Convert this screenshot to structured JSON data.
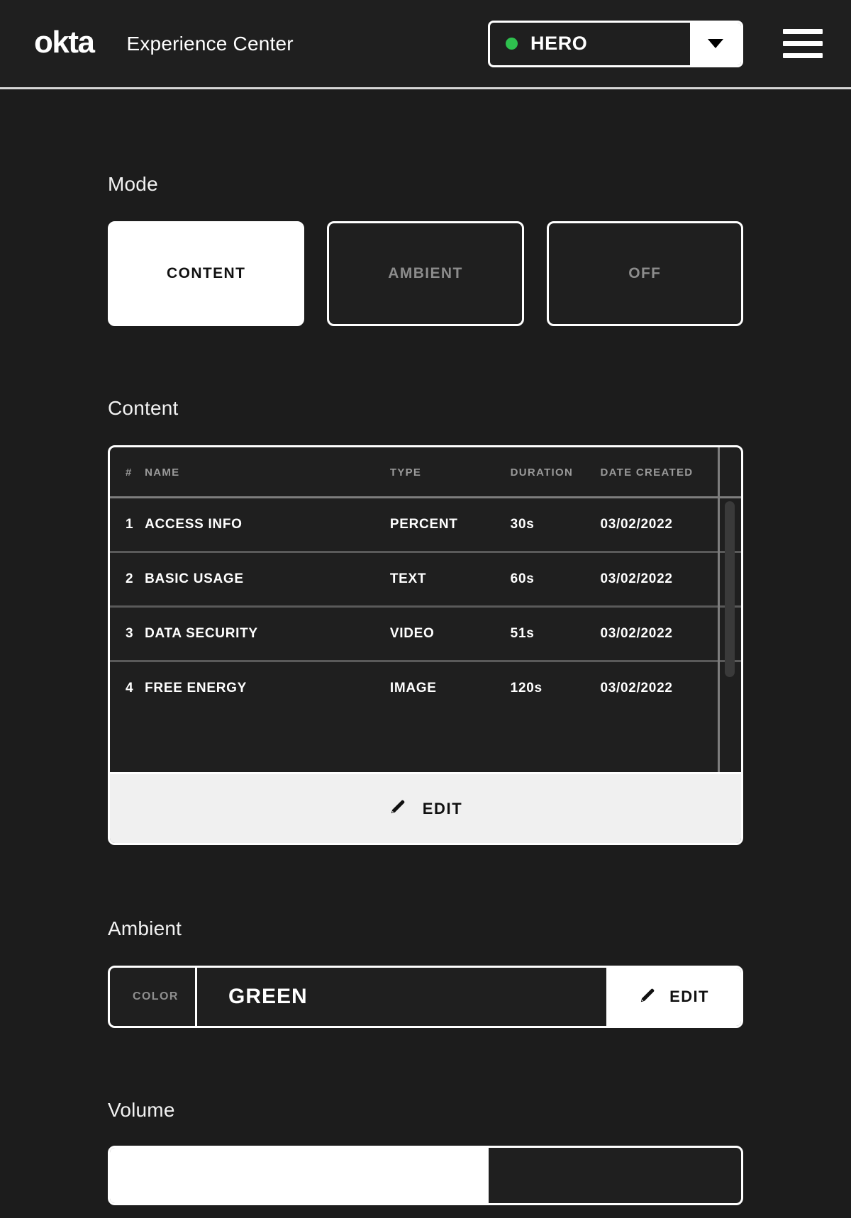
{
  "header": {
    "logo_text": "okta",
    "app_title": "Experience Center",
    "device_selector": {
      "name": "HERO",
      "status_color": "#2ec04e",
      "caret_icon": "chevron-down-icon"
    },
    "menu_icon": "hamburger-menu-icon"
  },
  "mode": {
    "label": "Mode",
    "options": [
      {
        "label": "CONTENT",
        "active": true
      },
      {
        "label": "AMBIENT",
        "active": false
      },
      {
        "label": "OFF",
        "active": false
      }
    ]
  },
  "content": {
    "label": "Content",
    "columns": [
      "#",
      "NAME",
      "TYPE",
      "DURATION",
      "DATE CREATED"
    ],
    "rows": [
      {
        "num": "1",
        "name": "ACCESS INFO",
        "type": "PERCENT",
        "duration": "30s",
        "date": "03/02/2022"
      },
      {
        "num": "2",
        "name": "BASIC USAGE",
        "type": "TEXT",
        "duration": "60s",
        "date": "03/02/2022"
      },
      {
        "num": "3",
        "name": "DATA SECURITY",
        "type": "VIDEO",
        "duration": "51s",
        "date": "03/02/2022"
      },
      {
        "num": "4",
        "name": "FREE ENERGY",
        "type": "IMAGE",
        "duration": "120s",
        "date": "03/02/2022"
      }
    ],
    "edit_label": "EDIT",
    "edit_icon": "pencil-icon"
  },
  "ambient": {
    "label": "Ambient",
    "key": "COLOR",
    "value": "GREEN",
    "edit_label": "EDIT",
    "edit_icon": "pencil-icon"
  },
  "volume": {
    "label": "Volume",
    "percent": 60
  },
  "colors": {
    "background": "#1c1c1c",
    "surface": "#1f1f1f",
    "accent": "#ffffff",
    "status_green": "#2ec04e",
    "edit_bar": "#f0f0f0"
  }
}
